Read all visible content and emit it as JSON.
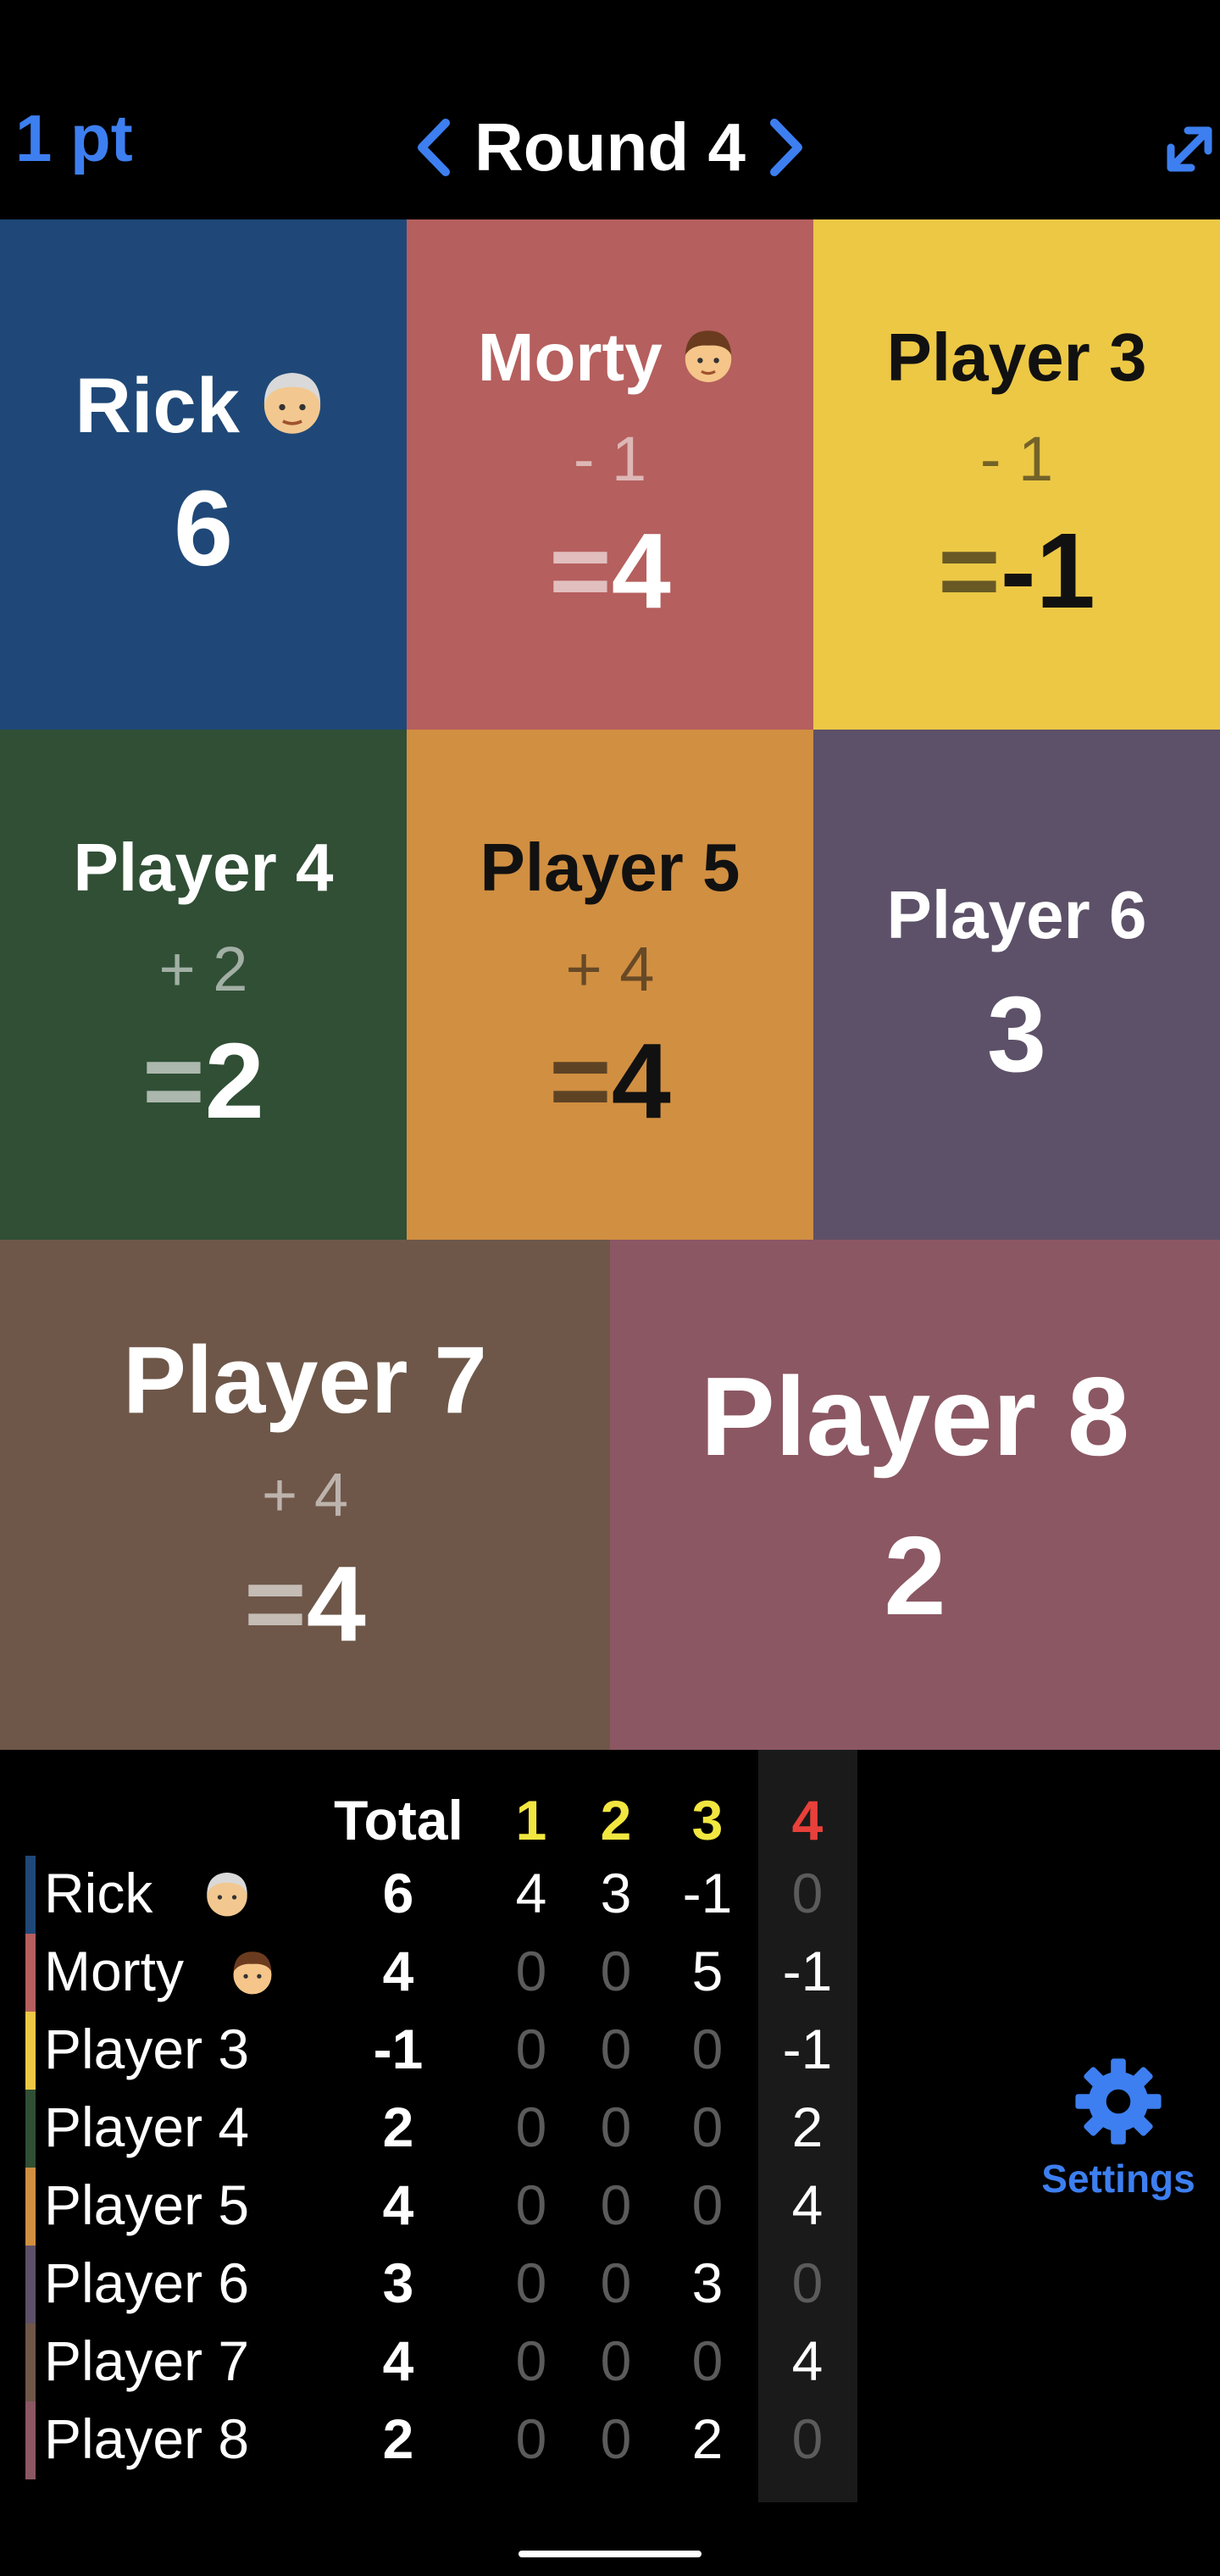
{
  "header": {
    "points_label": "1 pt",
    "round_title": "Round 4",
    "accent": "#3d7ff0",
    "icons": [
      "chevron-left-icon",
      "chevron-right-icon",
      "expand-icon"
    ]
  },
  "tiles": [
    {
      "name": "Rick",
      "emoji": "old-man-emoji",
      "delta": "",
      "score": "6",
      "color": "#1f4878"
    },
    {
      "name": "Morty",
      "emoji": "boy-emoji",
      "delta": "- 1",
      "eq": "=",
      "score": "4",
      "color": "#b55f5e"
    },
    {
      "name": "Player 3",
      "delta": "- 1",
      "eq": "=",
      "score": "-1",
      "color": "#ecc845"
    },
    {
      "name": "Player 4",
      "delta": "+ 2",
      "eq": "=",
      "score": "2",
      "color": "#304f35"
    },
    {
      "name": "Player 5",
      "delta": "+ 4",
      "eq": "=",
      "score": "4",
      "color": "#d18f41"
    },
    {
      "name": "Player 6",
      "delta": "",
      "score": "3",
      "color": "#5d5169"
    },
    {
      "name": "Player 7",
      "delta": "+ 4",
      "eq": "=",
      "score": "4",
      "color": "#6e5749"
    },
    {
      "name": "Player 8",
      "delta": "",
      "score": "2",
      "color": "#8b5763"
    }
  ],
  "table": {
    "headers": {
      "total": "Total",
      "rounds": [
        "1",
        "2",
        "3",
        "4"
      ]
    },
    "round_colors": [
      "#f2e640",
      "#f2e640",
      "#f2e640",
      "#e8403a"
    ],
    "rows": [
      {
        "name": "Rick",
        "total": "6",
        "rounds": [
          "4",
          "3",
          "-1",
          "0"
        ],
        "color": "#1f4878"
      },
      {
        "name": "Morty",
        "total": "4",
        "rounds": [
          "0",
          "0",
          "5",
          "-1"
        ],
        "color": "#b55f5e"
      },
      {
        "name": "Player 3",
        "total": "-1",
        "rounds": [
          "0",
          "0",
          "0",
          "-1"
        ],
        "color": "#ecc845"
      },
      {
        "name": "Player 4",
        "total": "2",
        "rounds": [
          "0",
          "0",
          "0",
          "2"
        ],
        "color": "#304f35"
      },
      {
        "name": "Player 5",
        "total": "4",
        "rounds": [
          "0",
          "0",
          "0",
          "4"
        ],
        "color": "#d18f41"
      },
      {
        "name": "Player 6",
        "total": "3",
        "rounds": [
          "0",
          "0",
          "3",
          "0"
        ],
        "color": "#5d5169"
      },
      {
        "name": "Player 7",
        "total": "4",
        "rounds": [
          "0",
          "0",
          "0",
          "4"
        ],
        "color": "#6e5749"
      },
      {
        "name": "Player 8",
        "total": "2",
        "rounds": [
          "0",
          "0",
          "2",
          "0"
        ],
        "color": "#8b5763"
      }
    ]
  },
  "settings": {
    "label": "Settings",
    "icon": "gear-icon"
  }
}
